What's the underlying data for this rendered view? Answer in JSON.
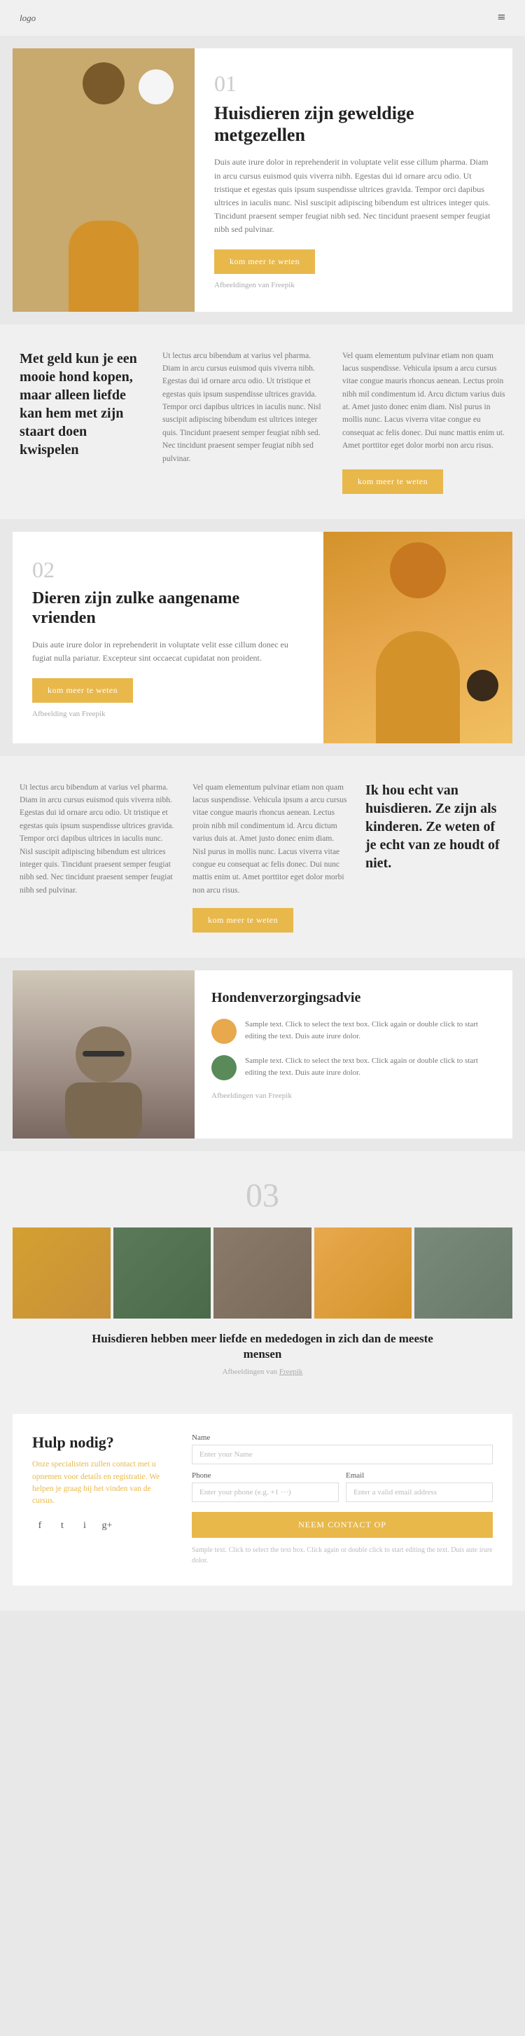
{
  "header": {
    "logo": "logo",
    "menu_icon": "≡"
  },
  "section1": {
    "number": "01",
    "title": "Huisdieren zijn geweldige metgezellen",
    "description": "Duis aute irure dolor in reprehenderit in voluptate velit esse cillum pharma. Diam in arcu cursus euismod quis viverra nibh. Egestas dui id ornare arcu odio. Ut tristique et egestas quis ipsum suspendisse ultrices gravida. Tempor orci dapibus ultrices in iaculis nunc. Nisl suscipit adipiscing bibendum est ultrices integer quis. Tincidunt praesent semper feugiat nibh sed. Nec tincidunt praesent semper feugiat nibh sed pulvinar.",
    "btn_label": "kom meer te weten",
    "image_credit": "Afbeeldingen van Freepik"
  },
  "section2": {
    "heading": "Met geld kun je een mooie hond kopen, maar alleen liefde kan hem met zijn staart doen kwispelen",
    "col2_text": "Ut lectus arcu bibendum at varius vel pharma. Diam in arcu cursus euismod quis viverra nibh. Egestas dui id ornare arcu odio. Ut tristique et egestas quis ipsum suspendisse ultrices gravida. Tempor orci dapibus ultrices in iaculis nunc. Nisl suscipit adipiscing bibendum est ultrices integer quis. Tincidunt praesent semper feugiat nibh sed. Nec tincidunt praesent semper feugiat nibh sed pulvinar.",
    "col3_text": "Vel quam elementum pulvinar etiam non quam lacus suspendisse. Vehicula ipsum a arcu cursus vitae congue mauris rhoncus aenean. Lectus proin nibh mil condimentum id. Arcu dictum varius duis at. Amet justo donec enim diam. Nisl purus in mollis nunc. Lacus viverra vitae congue eu consequat ac felis donec. Dui nunc mattis enim ut. Amet porttitor eget dolor morbi non arcu risus.",
    "btn_label": "kom meer te weten"
  },
  "section3": {
    "number": "02",
    "title": "Dieren zijn zulke aangename vrienden",
    "description": "Duis aute irure dolor in reprehenderit in voluptate velit esse cillum donec eu fugiat nulla pariatur. Excepteur sint occaecat cupidatat non proident.",
    "btn_label": "kom meer te weten",
    "image_credit": "Afbeelding van Freepik"
  },
  "section4": {
    "col1_text": "Ut lectus arcu bibendum at varius vel pharma. Diam in arcu cursus euismod quis viverra nibh. Egestas dui id ornare arcu odio. Ut tristique et egestas quis ipsum suspendisse ultrices gravida. Tempor orci dapibus ultrices in iaculis nunc. Nisl suscipit adipiscing bibendum est ultrices integer quis. Tincidunt praesent semper feugiat nibh sed. Nec tincidunt praesent semper feugiat nibh sed pulvinar.",
    "col2_text": "Vel quam elementum pulvinar etiam non quam lacus suspendisse. Vehicula ipsum a arcu cursus vitae congue mauris rhoncus aenean. Lectus proin nibh mil condimentum id. Arcu dictum varius duis at. Amet justo donec enim diam. Nisl purus in mollis nunc. Lacus viverra vitae congue eu consequat ac felis donec. Dui nunc mattis enim ut. Amet porttitor eget dolor morbi non arcu risus.",
    "col3_quote": "Ik hou echt van huisdieren. Ze zijn als kinderen. Ze weten of je echt van ze houdt of niet.",
    "btn_label": "kom meer te weten"
  },
  "section5": {
    "title": "Hondenverzorgingsadvie",
    "item1_text": "Sample text. Click to select the text box. Click again or double click to start editing the text. Duis aute irure dolor.",
    "item2_text": "Sample text. Click to select the text box. Click again or double click to start editing the text. Duis aute irure dolor.",
    "image_credit": "Afbeeldingen van Freepik"
  },
  "section6": {
    "number": "03",
    "caption": "Huisdieren hebben meer liefde en mededogen in zich dan de meeste mensen",
    "credit_text": "Afbeeldingen van",
    "credit_link": "Freepik"
  },
  "contact": {
    "title": "Hulp nodig?",
    "description": "Onze specialisten zullen contact met u opnemen voor details en registratie. We helpen je graag bij het vinden van de cursus.",
    "social_icons": [
      "f",
      "t",
      "i",
      "g+"
    ],
    "name_label": "Name",
    "name_placeholder": "Enter your Name",
    "phone_label": "Phone",
    "phone_placeholder": "Enter your phone (e.g. +1 ···)",
    "email_label": "Email",
    "email_placeholder": "Enter a valid email address",
    "btn_label": "NEEM CONTACT OP",
    "sample_text": "Sample text. Click to select the text box. Click again or double click to start editing the text. Duis aute irure dolor."
  }
}
